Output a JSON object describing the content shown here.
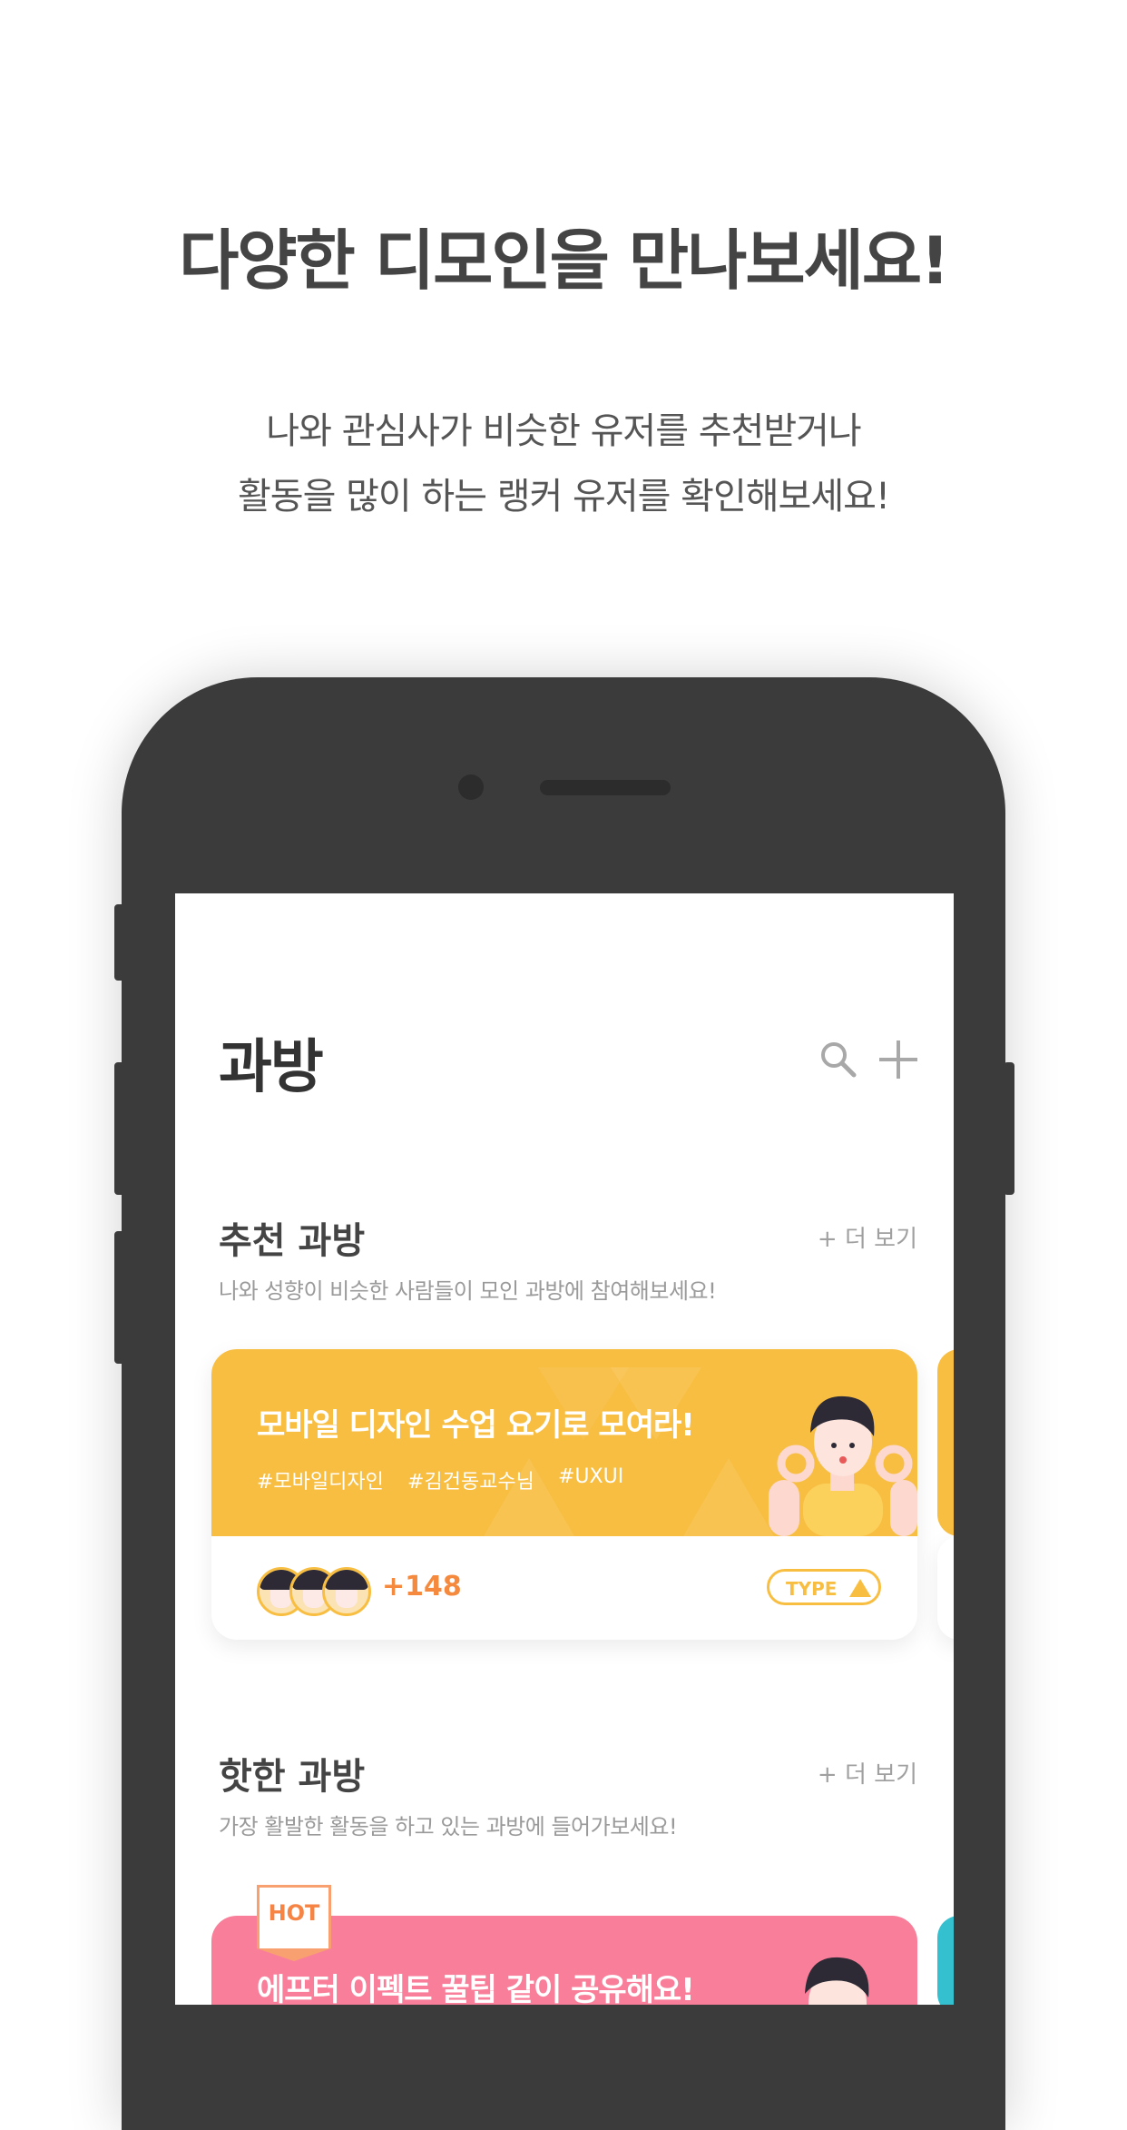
{
  "promo": {
    "headline": "다양한 디모인을 만나보세요!",
    "subline_1": "나와 관심사가 비슷한 유저를 추천받거나",
    "subline_2": "활동을 많이 하는 랭커 유저를 확인해보세요!"
  },
  "app": {
    "title": "과방",
    "icons": [
      "search-icon",
      "plus-icon"
    ]
  },
  "recommended": {
    "title": "추천 과방",
    "more": "+ 더 보기",
    "description": "나와 성향이 비슷한 사람들이 모인 과방에 참여해보세요!",
    "card": {
      "title": "모바일 디자인 수업 요기로 모여라!",
      "tags": [
        "#모바일디자인",
        "#김건동교수님",
        "#UXUI"
      ],
      "member_count": "+148",
      "type_label": "TYPE",
      "accent": "#f8be42"
    }
  },
  "hot": {
    "title": "핫한 과방",
    "more": "+ 더 보기",
    "description": "가장 활발한 활동을 하고 있는 과방에 들어가보세요!",
    "badge": "HOT",
    "card": {
      "title": "에프터 이펙트 꿀팁 같이 공유해요!",
      "accent": "#f87e9a"
    }
  },
  "colors": {
    "phone_body": "#3b3b3b",
    "peek_yellow": "#f8be42",
    "peek_teal": "#35c0cf"
  }
}
